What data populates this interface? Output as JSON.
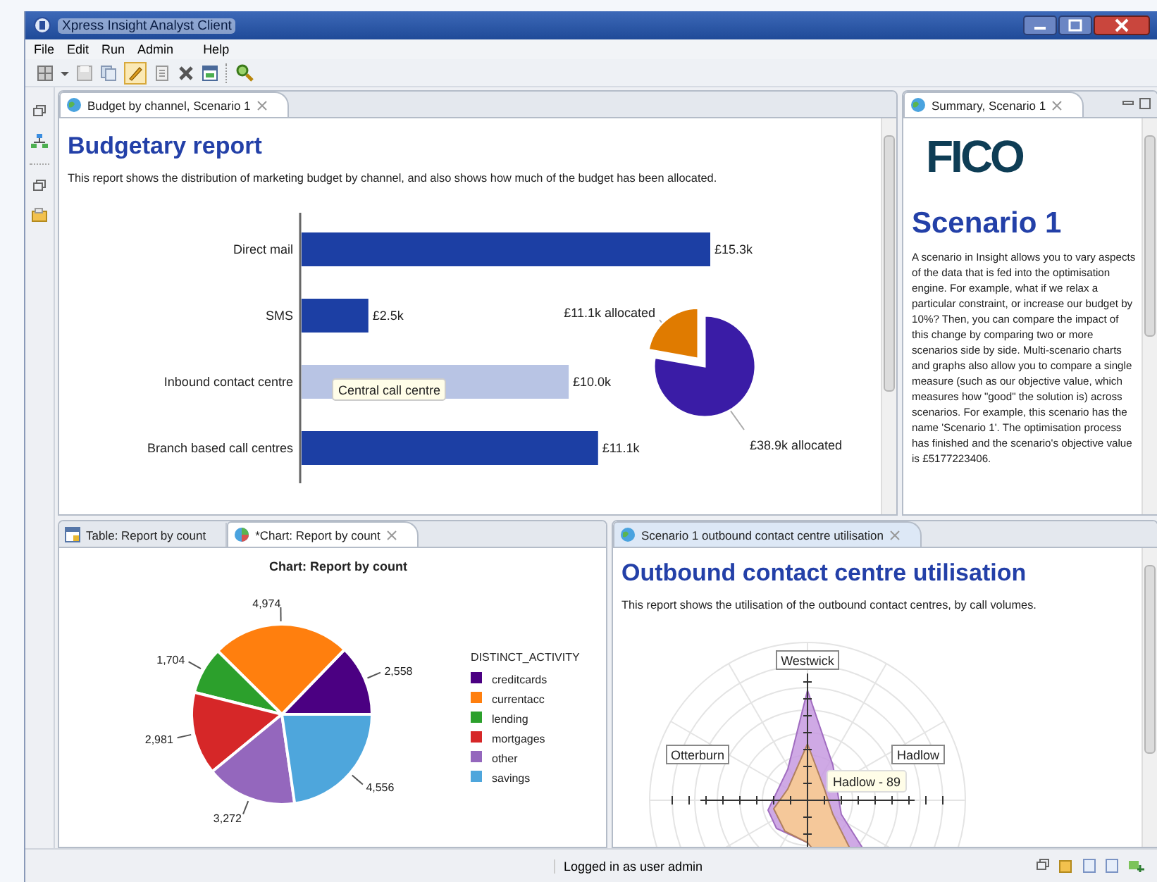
{
  "window": {
    "title": "Xpress Insight Analyst Client"
  },
  "menu": [
    {
      "label": "File"
    },
    {
      "label": "Edit"
    },
    {
      "label": "Run"
    },
    {
      "label": "Admin"
    },
    {
      "label": "Help"
    }
  ],
  "budget_panel": {
    "tab": {
      "label": "Budget by channel, Scenario 1",
      "selected": true
    },
    "heading": "Budgetary report",
    "description": "This report shows the distribution of marketing budget by channel, and also shows how much of the budget has been allocated.",
    "bar_chart": {
      "tooltip": "Central call centre",
      "chart_data": {
        "type": "bar",
        "orientation": "horizontal",
        "categories": [
          "Direct mail",
          "SMS",
          "Inbound contact centre",
          "Branch based call centres"
        ],
        "series": [
          {
            "color": "#1c3fa4",
            "values": [
              15.3,
              2.5,
              null,
              11.1
            ],
            "value_labels": [
              "£15.3k",
              "£2.5k",
              null,
              "£11.1k"
            ]
          },
          {
            "color": "#b8c4e4",
            "values": [
              null,
              null,
              10.0,
              null
            ],
            "value_labels": [
              null,
              null,
              "£10.0k",
              null
            ]
          }
        ]
      }
    },
    "pie_chart": {
      "chart_data": {
        "type": "pie",
        "values": [
          11.1,
          38.9
        ],
        "colors": [
          "#e07b00",
          "#3a1ca6"
        ],
        "value_labels": [
          "£11.1k allocated",
          "£38.9k allocated"
        ]
      }
    }
  },
  "summary_panel": {
    "tab": {
      "label": "Summary, Scenario 1",
      "selected": true
    },
    "logo": "FICO",
    "heading": "Scenario 1",
    "body": "A scenario in Insight allows you to vary aspects of the data that is fed into the optimisation engine. For example, what if we relax a particular constraint, or increase our budget by 10%? Then, you can compare the impact of this change by comparing two or more scenarios side by side. Multi-scenario charts and graphs also allow you to compare a single measure (such as our objective value, which measures how \"good\" the solution is) across scenarios. For example, this scenario has the name 'Scenario 1'. The optimisation process has finished and the scenario's objective value is £5177223406."
  },
  "count_panel": {
    "tabs": [
      {
        "label": "Table: Report by count",
        "selected": false
      },
      {
        "label": "*Chart: Report by count",
        "selected": true
      }
    ],
    "legend_title": "DISTINCT_ACTIVITY",
    "chart_data": {
      "type": "pie",
      "title": "Chart: Report by count",
      "legend": "right",
      "categories": [
        "creditcards",
        "currentacc",
        "lending",
        "mortgages",
        "other",
        "savings"
      ],
      "values": [
        2558,
        4974,
        1704,
        2981,
        3272,
        4556
      ],
      "colors": [
        "#4b0082",
        "#ff7f0e",
        "#2ca02c",
        "#d62728",
        "#9467bd",
        "#4ea6dc"
      ],
      "value_labels": [
        "2,558",
        "4,974",
        "1,704",
        "2,981",
        "3,272",
        "4,556"
      ]
    }
  },
  "utilisation_panel": {
    "tab": {
      "label": "Scenario 1 outbound contact centre utilisation",
      "selected": true
    },
    "heading": "Outbound contact centre utilisation",
    "description": "This report shows the utilisation of the outbound contact centres, by call volumes.",
    "radar_labels": [
      "Westwick",
      "Otterburn",
      "Hadlow"
    ],
    "tooltip": "Hadlow - 89"
  },
  "status_bar": {
    "text": "Logged in as user admin"
  }
}
